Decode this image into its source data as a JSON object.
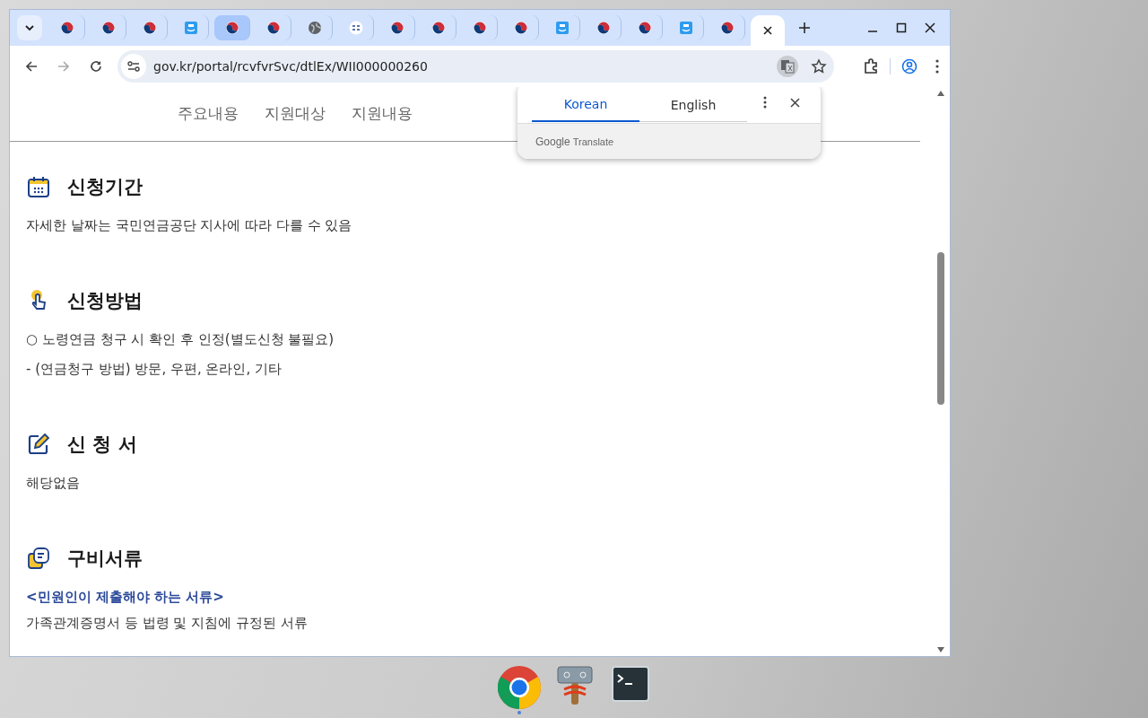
{
  "tabs": [
    {
      "kind": "emblem",
      "selected": false,
      "hovered": false
    },
    {
      "kind": "emblem",
      "selected": false,
      "hovered": false
    },
    {
      "kind": "emblem",
      "selected": false,
      "hovered": false
    },
    {
      "kind": "app",
      "selected": false,
      "hovered": false
    },
    {
      "kind": "emblem",
      "selected": false,
      "hovered": true
    },
    {
      "kind": "emblem",
      "selected": false,
      "hovered": false
    },
    {
      "kind": "globe",
      "selected": false,
      "hovered": false
    },
    {
      "kind": "badge",
      "selected": false,
      "hovered": false
    },
    {
      "kind": "emblem",
      "selected": false,
      "hovered": false
    },
    {
      "kind": "emblem",
      "selected": false,
      "hovered": false
    },
    {
      "kind": "emblem",
      "selected": false,
      "hovered": false
    },
    {
      "kind": "emblem",
      "selected": false,
      "hovered": false
    },
    {
      "kind": "app",
      "selected": false,
      "hovered": false
    },
    {
      "kind": "emblem",
      "selected": false,
      "hovered": false
    },
    {
      "kind": "emblem",
      "selected": false,
      "hovered": false
    },
    {
      "kind": "app",
      "selected": false,
      "hovered": false
    },
    {
      "kind": "emblem",
      "selected": false,
      "hovered": false
    },
    {
      "kind": "none",
      "selected": true,
      "hovered": false
    }
  ],
  "address_bar": {
    "url": "gov.kr/portal/rcvfvrSvc/dtlEx/WII000000260"
  },
  "page_nav": [
    "주요내용",
    "지원대상",
    "지원내용"
  ],
  "sections": [
    {
      "kind": "calendar",
      "title": "신청기간",
      "lines": [
        {
          "kind": "text",
          "text": "자세한 날짜는 국민연금공단 지사에 따라 다를 수 있음"
        }
      ]
    },
    {
      "kind": "hand",
      "title": "신청방법",
      "lines": [
        {
          "kind": "text",
          "text": "○ 노령연금 청구 시 확인 후 인정(별도신청 불필요)"
        },
        {
          "kind": "text",
          "text": "- (연금청구 방법) 방문, 우편, 온라인, 기타"
        }
      ]
    },
    {
      "kind": "pen",
      "title": "신 청 서",
      "lines": [
        {
          "kind": "text",
          "text": "해당없음"
        }
      ]
    },
    {
      "kind": "docs",
      "title": "구비서류",
      "lines": [
        {
          "kind": "subheading",
          "text": "<민원인이 제출해야 하는 서류>"
        },
        {
          "kind": "text",
          "text": "가족관계증명서 등 법령 및 지침에 규정된 서류"
        }
      ]
    }
  ],
  "translate_popup": {
    "tabs": [
      {
        "label": "Korean",
        "selected": true
      },
      {
        "label": "English",
        "selected": false
      }
    ],
    "brand": "Google",
    "product": "Translate"
  },
  "taskbar": [
    {
      "kind": "chrome",
      "running": true
    },
    {
      "kind": "tool",
      "running": false
    },
    {
      "kind": "terminal",
      "running": false
    }
  ]
}
